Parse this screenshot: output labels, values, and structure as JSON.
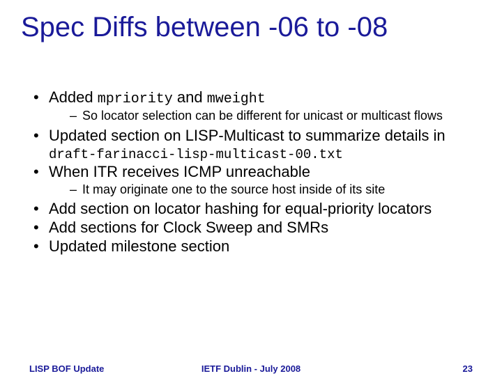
{
  "title": "Spec Diffs between -06 to -08",
  "bullets": {
    "b1": {
      "pre": "Added ",
      "code1": "mpriority",
      "mid": " and ",
      "code2": "mweight",
      "sub": "So locator selection can be different for unicast or multicast flows"
    },
    "b2": {
      "pre": "Updated section on LISP-Multicast to summarize details in ",
      "code": "draft-farinacci-lisp-multicast-00.txt"
    },
    "b3": {
      "text": "When ITR receives ICMP unreachable",
      "sub": "It may originate one to the source host inside of its site"
    },
    "b4": "Add section on locator hashing for equal-priority locators",
    "b5": "Add sections for Clock Sweep and SMRs",
    "b6": "Updated milestone section"
  },
  "footer": {
    "left": "LISP BOF Update",
    "center": "IETF Dublin - July 2008",
    "right": "23"
  }
}
